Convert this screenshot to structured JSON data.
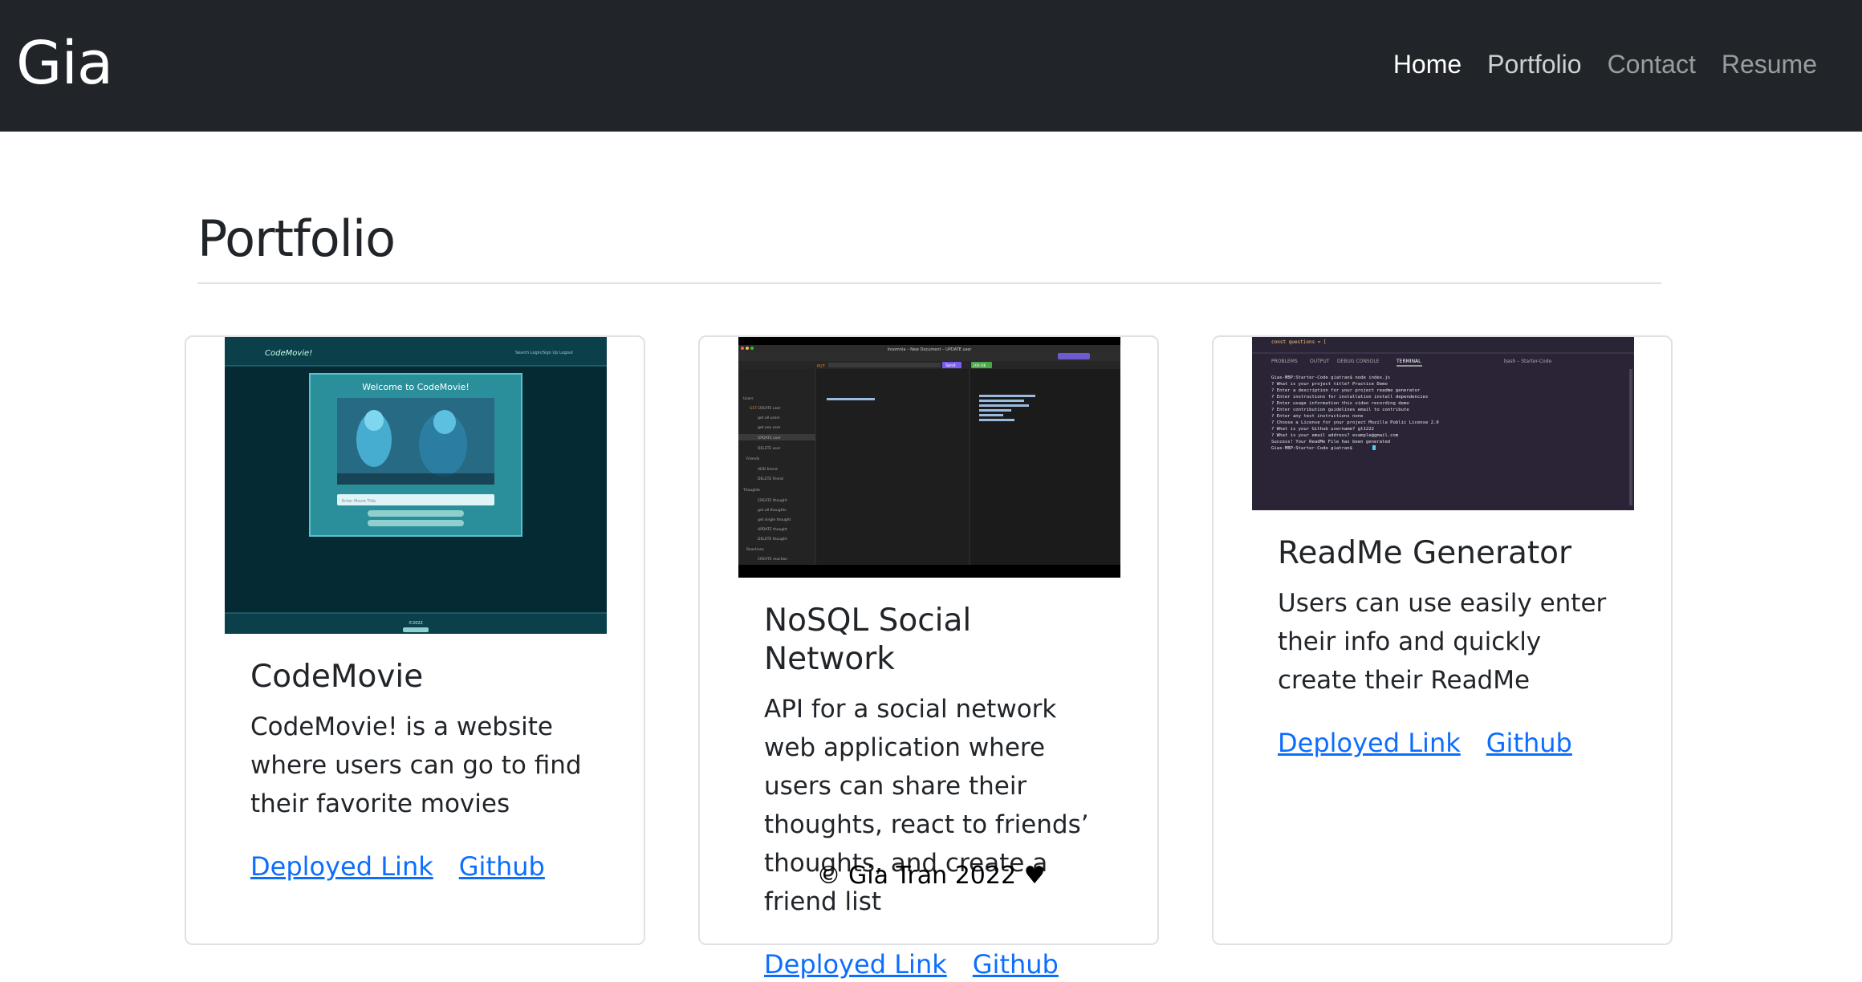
{
  "navbar": {
    "brand": "Gia",
    "links": [
      {
        "label": "Home"
      },
      {
        "label": "Portfolio"
      },
      {
        "label": "Contact"
      },
      {
        "label": "Resume"
      }
    ]
  },
  "page": {
    "title": "Portfolio"
  },
  "cards": [
    {
      "title": "CodeMovie",
      "text": "CodeMovie! is a website where users can go to find their favorite movies",
      "deployed": "Deployed Link",
      "github": "Github",
      "screenshot": {
        "header_brand": "CodeMovie!",
        "header_nav": "Search  Login/Sign Up  Logout",
        "welcome": "Welcome to CodeMovie!",
        "search_placeholder": "Enter Movie Title",
        "footer": "©2022"
      }
    },
    {
      "title": "NoSQL Social Network",
      "text": "API for a social network web application where users can share their thoughts, react to friends’ thoughts, and create a friend list",
      "deployed": "Deployed Link",
      "github": "Github",
      "screenshot": {
        "window_title": "Insomnia – New Document – UPDATE user",
        "method": "PUT",
        "send": "Send",
        "status": "200 OK",
        "sidebar": [
          "Users",
          "GET",
          "CREATE user",
          "get all users",
          "get one user",
          "UPDATE user",
          "DELETE user",
          "Friends",
          "ADD friend",
          "DELETE friend",
          "Thoughts",
          "CREATE thought",
          "get all thoughts",
          "get single thought",
          "UPDATE thought",
          "DELETE thought",
          "Reactions",
          "CREATE reaction"
        ]
      }
    },
    {
      "title": "ReadMe Generator",
      "text": "Users can use easily enter their info and quickly create their ReadMe",
      "deployed": "Deployed Link",
      "github": "Github",
      "screenshot": {
        "tabs": [
          "PROBLEMS",
          "OUTPUT",
          "DEBUG CONSOLE",
          "TERMINAL"
        ],
        "shell": "bash – Starter-Code",
        "lines": [
          "const questions = [",
          "Gias-MBP:Starter-Code giatran$ node index.js",
          "? What is your project title? Practice Demo",
          "? Enter a description for your project readme generator",
          "? Enter instructions for installation install dependencies",
          "? Enter usage information this video recording demo",
          "? Enter contribution guidelines email to contribute",
          "? Enter any test instructions none",
          "? Choose a License for your project Mozilla Public License 2.0",
          "? What is your Github username? gt1222",
          "? What is your email address? example@gmail.com",
          "Success! Your ReadMe File has been generated",
          "Gias-MBP:Starter-Code giatran$"
        ]
      }
    }
  ],
  "footer": {
    "text": "© Gia Tran 2022 ♥"
  }
}
